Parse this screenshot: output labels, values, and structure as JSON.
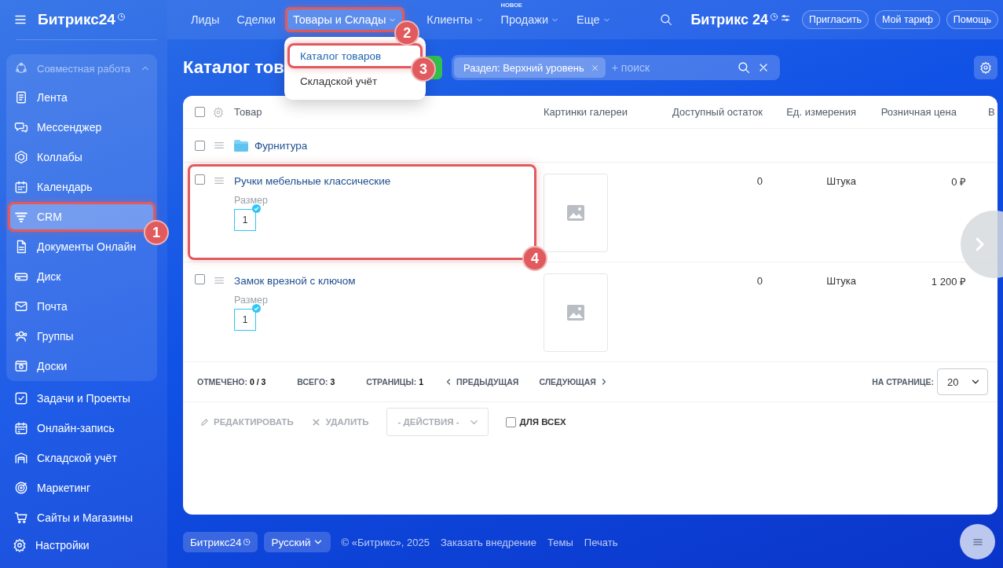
{
  "sidebar": {
    "logo": "Битрикс24",
    "group": {
      "title": "Совместная работа",
      "expanded": true,
      "items": [
        {
          "label": "Лента",
          "selected": false
        },
        {
          "label": "Мессенджер",
          "selected": false
        },
        {
          "label": "Коллабы",
          "selected": false
        },
        {
          "label": "Календарь",
          "selected": false
        },
        {
          "label": "CRM",
          "selected": true,
          "callout": "1"
        },
        {
          "label": "Документы Онлайн",
          "selected": false
        },
        {
          "label": "Диск",
          "selected": false
        },
        {
          "label": "Почта",
          "selected": false
        },
        {
          "label": "Группы",
          "selected": false
        },
        {
          "label": "Доски",
          "selected": false
        }
      ]
    },
    "items": [
      {
        "label": "Задачи и Проекты",
        "selected": false
      },
      {
        "label": "Онлайн-запись",
        "selected": false
      },
      {
        "label": "Складской учёт",
        "selected": false
      },
      {
        "label": "Маркетинг",
        "selected": false
      },
      {
        "label": "Сайты и Магазины",
        "selected": false
      }
    ],
    "settings": "Настройки"
  },
  "topnav": {
    "items": [
      {
        "label": "Лиды",
        "dropdown": false,
        "selected": false
      },
      {
        "label": "Сделки",
        "dropdown": false,
        "selected": false
      },
      {
        "label": "Товары и Склады",
        "dropdown": true,
        "selected": true,
        "callout": "2"
      },
      {
        "label": "Клиенты",
        "dropdown": true,
        "selected": false
      },
      {
        "label": "Продажи",
        "dropdown": true,
        "selected": false,
        "badge": "НОВОЕ"
      },
      {
        "label": "Еще",
        "dropdown": true,
        "selected": false
      }
    ],
    "logo": "Битрикс 24",
    "buttons": [
      "Пригласить",
      "Мой тариф",
      "Помощь"
    ]
  },
  "menu": {
    "items": [
      {
        "label": "Каталог товаров",
        "selected": true,
        "callout": "3"
      },
      {
        "label": "Складской учёт",
        "selected": false
      }
    ]
  },
  "page": {
    "title": "Каталог тов",
    "filter": {
      "chip": "Раздел: Верхний уровень",
      "placeholder": "+ поиск"
    }
  },
  "table": {
    "all_checked": false,
    "columns": [
      "Товар",
      "Картинки галереи",
      "Доступный остаток",
      "Ед. измерения",
      "Розничная цена",
      "В"
    ],
    "rows": [
      {
        "kind": "folder",
        "checked": false,
        "name": "Фурнитура"
      },
      {
        "kind": "product",
        "checked": false,
        "name": "Ручки мебельные классические",
        "property": "Размер",
        "value": "1",
        "stock": "0",
        "unit": "Штука",
        "price": "0 ₽",
        "callout": "4"
      },
      {
        "kind": "product",
        "checked": false,
        "name": "Замок врезной с ключом",
        "property": "Размер",
        "value": "1",
        "stock": "0",
        "unit": "Штука",
        "price": "1 200 ₽"
      }
    ]
  },
  "pager": {
    "checked": "ОТМЕЧЕНО: **0 / 3**",
    "total": "ВСЕГО: **3**",
    "pages": "СТРАНИЦЫ: **1**",
    "prev": "ПРЕДЫДУЩАЯ",
    "next": "СЛЕДУЮЩАЯ",
    "per_page_label": "НА СТРАНИЦЕ:",
    "per_page": "20"
  },
  "actions": [
    {
      "kind": "button",
      "label": "РЕДАКТИРОВАТЬ",
      "disabled": true
    },
    {
      "kind": "button",
      "label": "УДАЛИТЬ",
      "disabled": true
    },
    {
      "kind": "select",
      "label": "- ДЕЙСТВИЯ -",
      "disabled": true
    },
    {
      "kind": "checkbox",
      "label": "ДЛЯ ВСЕХ",
      "checked": false
    }
  ],
  "footer": {
    "logo": "Битрикс24",
    "language": "Русский",
    "copyright": "© «Битрикс», 2025",
    "links": [
      "Заказать внедрение",
      "Темы",
      "Печать"
    ]
  }
}
